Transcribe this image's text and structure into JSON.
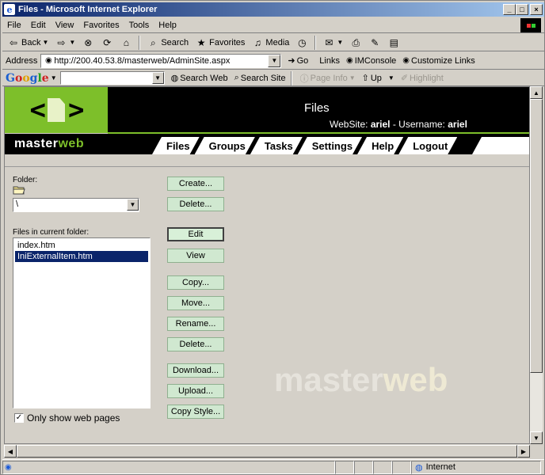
{
  "window": {
    "title": "Files - Microsoft Internet Explorer",
    "min": "_",
    "max": "□",
    "close": "×"
  },
  "menu": {
    "items": [
      "File",
      "Edit",
      "View",
      "Favorites",
      "Tools",
      "Help"
    ]
  },
  "toolbar": {
    "back": "Back",
    "search": "Search",
    "favorites": "Favorites",
    "media": "Media"
  },
  "address": {
    "label": "Address",
    "url": "http://200.40.53.8/masterweb/AdminSite.aspx",
    "go": "Go",
    "links": "Links",
    "link1": "IMConsole",
    "link2": "Customize Links"
  },
  "google": {
    "logo": "Google",
    "search_web": "Search Web",
    "search_site": "Search Site",
    "page_info": "Page Info",
    "up": "Up",
    "highlight": "Highlight"
  },
  "site": {
    "title": "Files",
    "website_label": "WebSite:",
    "website": "ariel",
    "username_label": "- Username:",
    "username": "ariel",
    "brand_a": "master",
    "brand_b": "web",
    "nav": [
      "Files",
      "Groups",
      "Tasks",
      "Settings",
      "Help",
      "Logout"
    ]
  },
  "files_panel": {
    "folder_label": "Folder:",
    "folder_value": "\\",
    "files_label": "Files in current folder:",
    "files": [
      "index.htm",
      "IniExternalItem.htm"
    ],
    "selected_index": 1,
    "only_web_label": "Only show web pages",
    "only_web_checked": "✓"
  },
  "buttons": {
    "folder_create": "Create...",
    "folder_delete": "Delete...",
    "edit": "Edit",
    "view": "View",
    "copy": "Copy...",
    "move": "Move...",
    "rename": "Rename...",
    "delete": "Delete...",
    "download": "Download...",
    "upload": "Upload...",
    "copy_style": "Copy Style..."
  },
  "watermark": {
    "a": "master",
    "b": "web"
  },
  "status": {
    "zone": "Internet"
  },
  "colors": {
    "brand_green": "#7dbf2a",
    "titlebar": "#0a246a",
    "button_bg": "#d0e8d0"
  }
}
